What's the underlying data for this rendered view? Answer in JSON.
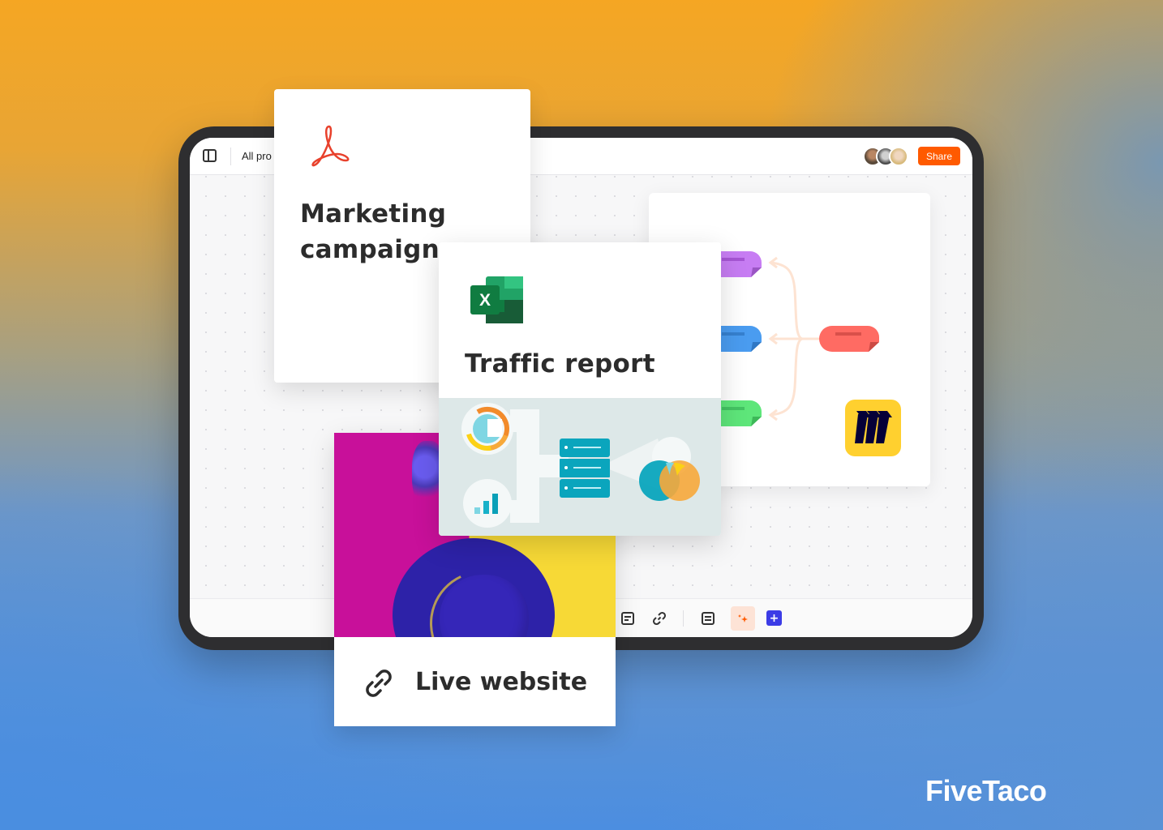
{
  "app": {
    "board_title": "All pro",
    "share_label": "Share",
    "collaborators": [
      "collaborator-1",
      "collaborator-2",
      "collaborator-3"
    ],
    "accent_color": "#ff5a00"
  },
  "toolbar": {
    "items": [
      {
        "icon": "sticky-note-icon"
      },
      {
        "icon": "link-icon"
      },
      {
        "icon": "text-doc-icon"
      },
      {
        "icon": "ai-sparkle-icon"
      },
      {
        "icon": "add-icon",
        "label": "+"
      }
    ]
  },
  "cards": {
    "marketing": {
      "title_line1": "Marketing",
      "title_line2": "campaign",
      "file_type": "pdf"
    },
    "traffic": {
      "title": "Traffic report",
      "file_type": "excel",
      "excel_letter": "X"
    },
    "live": {
      "title": "Live website"
    },
    "mindmap": {
      "nodes": [
        {
          "color": "#c77df3"
        },
        {
          "color": "#4a9cf0"
        },
        {
          "color": "#5ee67a"
        },
        {
          "color": "#ff6b63"
        }
      ]
    }
  },
  "brand": {
    "name": "FiveTaco"
  }
}
